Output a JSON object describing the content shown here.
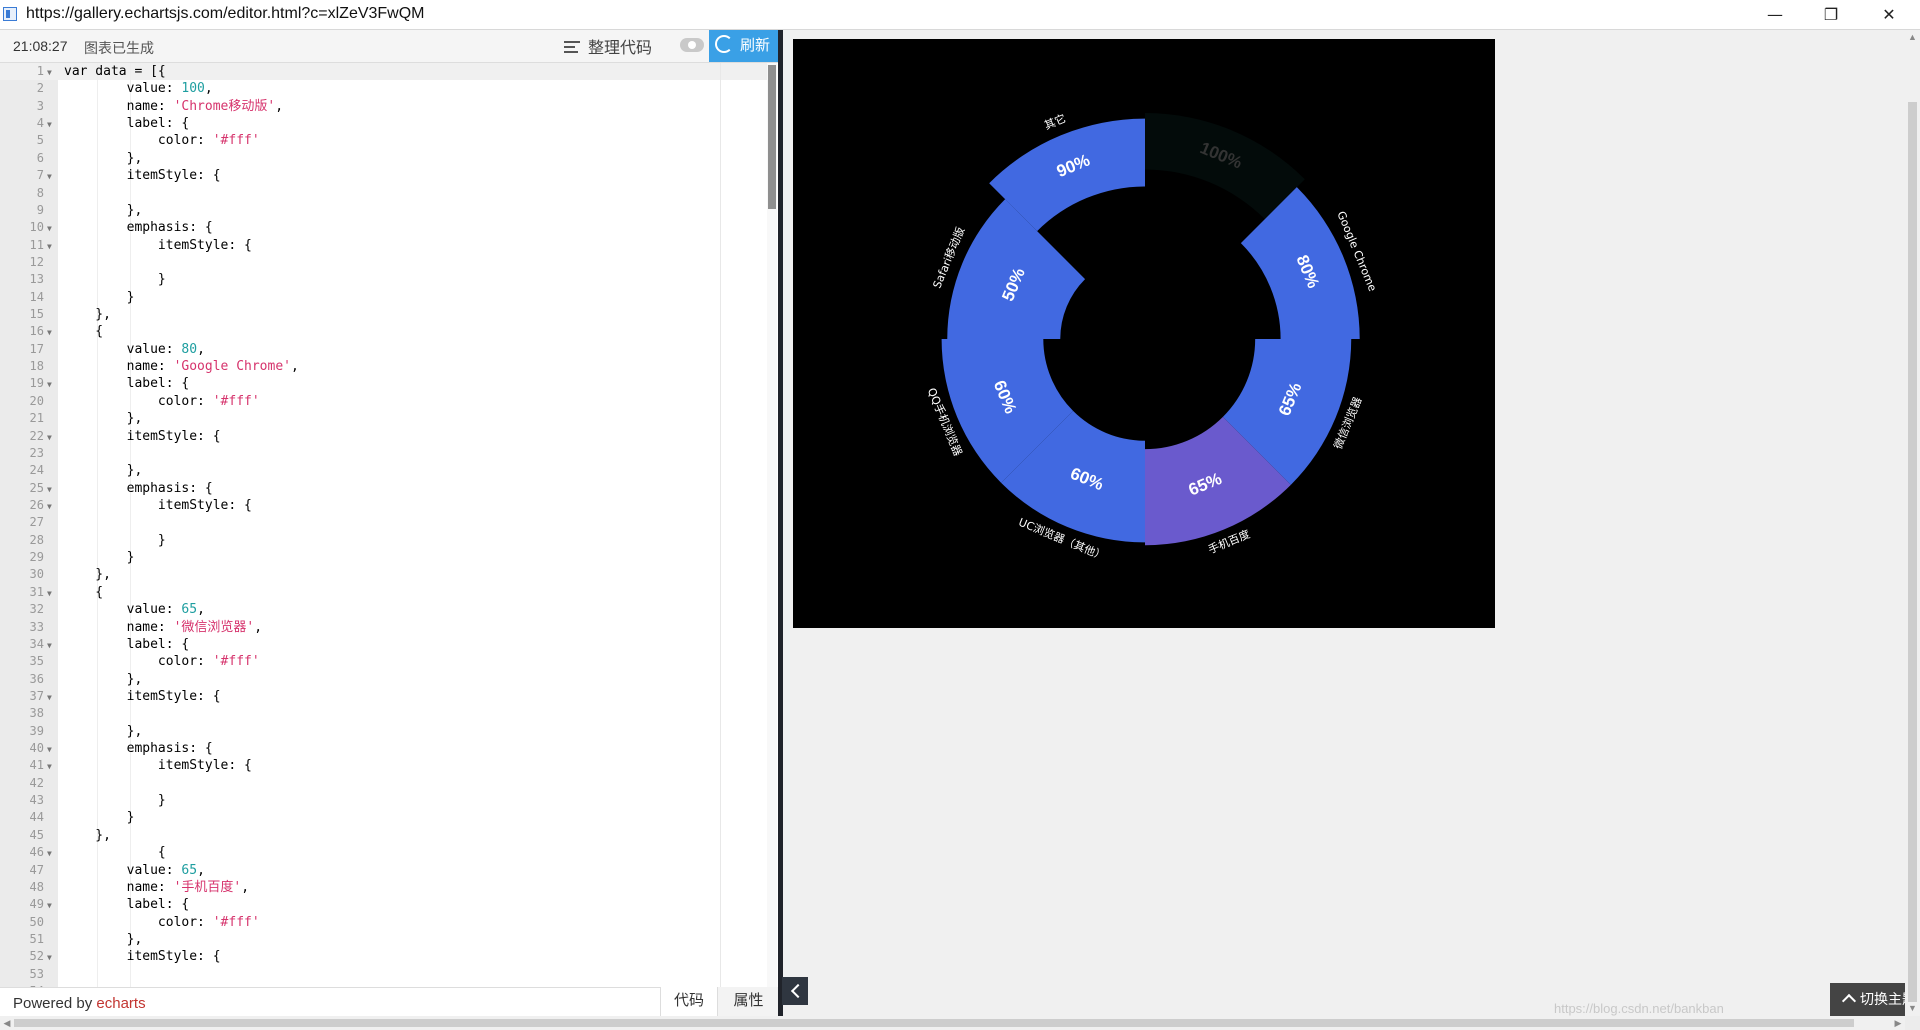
{
  "window": {
    "url": "https://gallery.echartsjs.com/editor.html?c=xlZeV3FwQM",
    "minimize_icon": "minimize-icon",
    "restore_icon": "restore-icon",
    "close_icon": "close-icon",
    "minimize_glyph": "—",
    "restore_glyph": "❐",
    "close_glyph": "✕"
  },
  "toolbar": {
    "time": "21:08:27",
    "status": "图表已生成",
    "format_label": "整理代码",
    "refresh_label": "刷新"
  },
  "editor": {
    "code_lines": [
      "var data = [{",
      "        value: 100,",
      "        name: 'Chrome移动版',",
      "        label: {",
      "            color: '#fff'",
      "        },",
      "        itemStyle: {",
      "",
      "        },",
      "        emphasis: {",
      "            itemStyle: {",
      "",
      "            }",
      "        }",
      "    },",
      "    {",
      "        value: 80,",
      "        name: 'Google Chrome',",
      "        label: {",
      "            color: '#fff'",
      "        },",
      "        itemStyle: {",
      "",
      "        },",
      "        emphasis: {",
      "            itemStyle: {",
      "",
      "            }",
      "        }",
      "    },",
      "    {",
      "        value: 65,",
      "        name: '微信浏览器',",
      "        label: {",
      "            color: '#fff'",
      "        },",
      "        itemStyle: {",
      "",
      "        },",
      "        emphasis: {",
      "            itemStyle: {",
      "",
      "            }",
      "        }",
      "    },",
      "            {",
      "        value: 65,",
      "        name: '手机百度',",
      "        label: {",
      "            color: '#fff'",
      "        },",
      "        itemStyle: {",
      "",
      ""
    ],
    "fold_lines": [
      1,
      4,
      7,
      10,
      11,
      16,
      19,
      22,
      25,
      26,
      31,
      34,
      37,
      40,
      41,
      46,
      49,
      52
    ]
  },
  "footer": {
    "powered_prefix": "Powered by ",
    "powered_brand": "echarts",
    "tab_code": "代码",
    "tab_props": "属性"
  },
  "chart_data": {
    "type": "pie",
    "rose_type": "radius",
    "start_angle": 90,
    "background": "#000000",
    "radius_range": [
      0.75,
      1.0
    ],
    "max_value": 100,
    "series": [
      {
        "name": "Chrome移动版",
        "value": 100,
        "label": "100%",
        "outer_label": "",
        "color": "#030b0a",
        "label_color": "#333333"
      },
      {
        "name": "Google Chrome",
        "value": 80,
        "label": "80%",
        "outer_label": "Google Chrome",
        "color": "#4169e1",
        "label_color": "#ffffff"
      },
      {
        "name": "微信浏览器",
        "value": 65,
        "label": "65%",
        "outer_label": "微信浏览器",
        "color": "#4169e1",
        "label_color": "#ffffff"
      },
      {
        "name": "手机百度",
        "value": 65,
        "label": "65%",
        "outer_label": "手机百度",
        "color": "#6a5acd",
        "label_color": "#ffffff"
      },
      {
        "name": "UC浏览器（其他）",
        "value": 60,
        "label": "60%",
        "outer_label": "UC浏览器（其他）",
        "color": "#4169e1",
        "label_color": "#ffffff"
      },
      {
        "name": "QQ手机浏览器",
        "value": 60,
        "label": "60%",
        "outer_label": "QQ手机浏览器",
        "color": "#4169e1",
        "label_color": "#ffffff"
      },
      {
        "name": "Safari移动版",
        "value": 50,
        "label": "50%",
        "outer_label": "Safari移动版",
        "color": "#4169e1",
        "label_color": "#ffffff"
      },
      {
        "name": "其它",
        "value": 90,
        "label": "90%",
        "outer_label": "其它",
        "color": "#4169e1",
        "label_color": "#ffffff"
      }
    ]
  },
  "preview": {
    "collapse_icon": "chevron-left-icon",
    "switch_label": "切换主题",
    "watermark": "https://blog.csdn.net/bankban"
  }
}
